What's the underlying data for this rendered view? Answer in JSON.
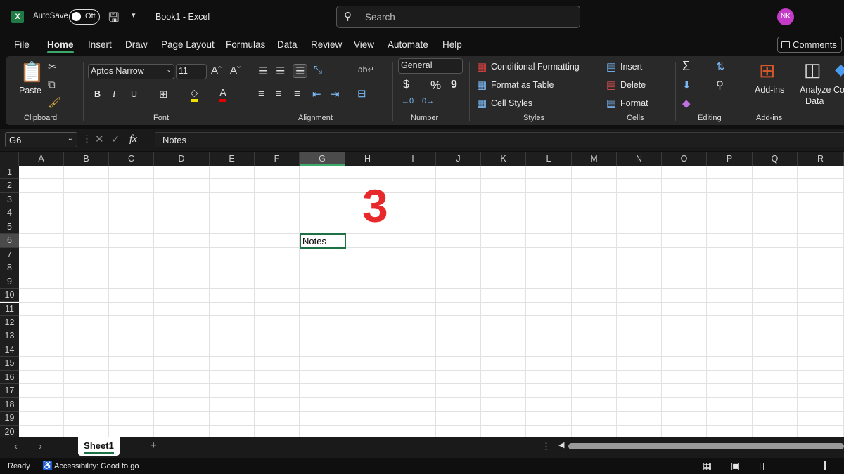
{
  "titlebar": {
    "app_icon": "X",
    "autosave_label": "AutoSave",
    "autosave_state": "Off",
    "title": "Book1  -  Excel",
    "search_placeholder": "Search",
    "avatar": "NK",
    "minimize": "—"
  },
  "tabs": [
    "File",
    "Home",
    "Insert",
    "Draw",
    "Page Layout",
    "Formulas",
    "Data",
    "Review",
    "View",
    "Automate",
    "Help"
  ],
  "active_tab": "Home",
  "comments_label": "Comments",
  "ribbon": {
    "clipboard": {
      "paste": "Paste",
      "group": "Clipboard"
    },
    "font": {
      "name": "Aptos Narrow",
      "size": "11",
      "bold": "B",
      "italic": "I",
      "underline": "U",
      "group": "Font"
    },
    "alignment": {
      "group": "Alignment"
    },
    "number": {
      "format": "General",
      "currency": "$",
      "percent": "%",
      "comma": "9",
      "group": "Number"
    },
    "styles": {
      "conditional": "Conditional Formatting",
      "format_table": "Format as Table",
      "cell_styles": "Cell Styles",
      "group": "Styles"
    },
    "cells": {
      "insert": "Insert",
      "delete": "Delete",
      "format": "Format",
      "group": "Cells"
    },
    "editing": {
      "group": "Editing",
      "sum": "Σ"
    },
    "addins": {
      "label": "Add-ins",
      "group": "Add-ins"
    },
    "analyze": {
      "line1": "Analyze",
      "line2": "Data",
      "copilot": "Co"
    }
  },
  "formula_bar": {
    "name_box": "G6",
    "fx": "fx",
    "content": "Notes"
  },
  "columns": [
    "A",
    "B",
    "C",
    "D",
    "E",
    "F",
    "G",
    "H",
    "I",
    "J",
    "K",
    "L",
    "M",
    "N",
    "O",
    "P",
    "Q",
    "R"
  ],
  "rows": [
    "1",
    "2",
    "3",
    "4",
    "5",
    "6",
    "7",
    "8",
    "9",
    "10",
    "11",
    "12",
    "13",
    "14",
    "15",
    "16",
    "17",
    "18",
    "19",
    "20"
  ],
  "selected_cell": {
    "col": "G",
    "row": "6",
    "value": "Notes"
  },
  "overlay_number": "3",
  "sheets": [
    "Sheet1"
  ],
  "status": {
    "ready": "Ready",
    "accessibility": "Accessibility: Good to go"
  }
}
